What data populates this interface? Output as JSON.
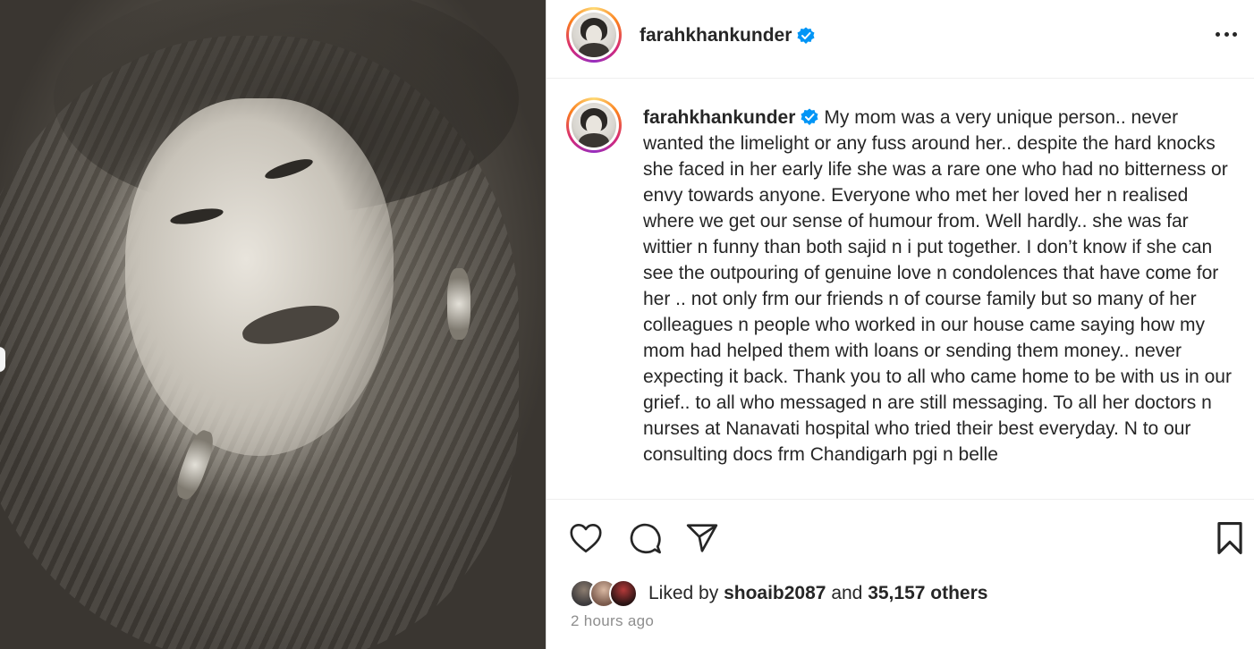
{
  "header": {
    "username": "farahkhankunder",
    "verified_icon": "verified-badge-icon",
    "more_icon": "more-options-icon"
  },
  "caption": {
    "username": "farahkhankunder",
    "text": "My mom was a very unique person.. never wanted the limelight or any fuss around her.. despite the hard knocks she faced in her early life she was a rare one who had no bitterness or envy towards anyone. Everyone who met her loved her n realised where we get our sense of humour from. Well hardly.. she was far wittier n funny than both sajid n i put together. I don’t know if she can see the outpouring of genuine love n condolences that have come for her .. not only frm our friends n of course family but so many of her colleagues n people who worked in our house came saying how my mom had helped them with loans or sending them money.. never expecting it back. Thank you to all who came home to be with us in our grief.. to all who messaged n are still messaging. To all her doctors n nurses at Nanavati hospital who tried their best everyday. N to our consulting docs frm Chandigarh pgi n belle"
  },
  "actions": {
    "like_icon": "heart-icon",
    "comment_icon": "comment-icon",
    "share_icon": "share-icon",
    "save_icon": "bookmark-icon"
  },
  "likes": {
    "prefix": "Liked by",
    "user": "shoaib2087",
    "and": "and",
    "others": "35,157 others"
  },
  "timestamp": "2 hours ago",
  "colors": {
    "verified": "#0095f6",
    "text": "#262626",
    "muted": "#8e8e8e"
  }
}
